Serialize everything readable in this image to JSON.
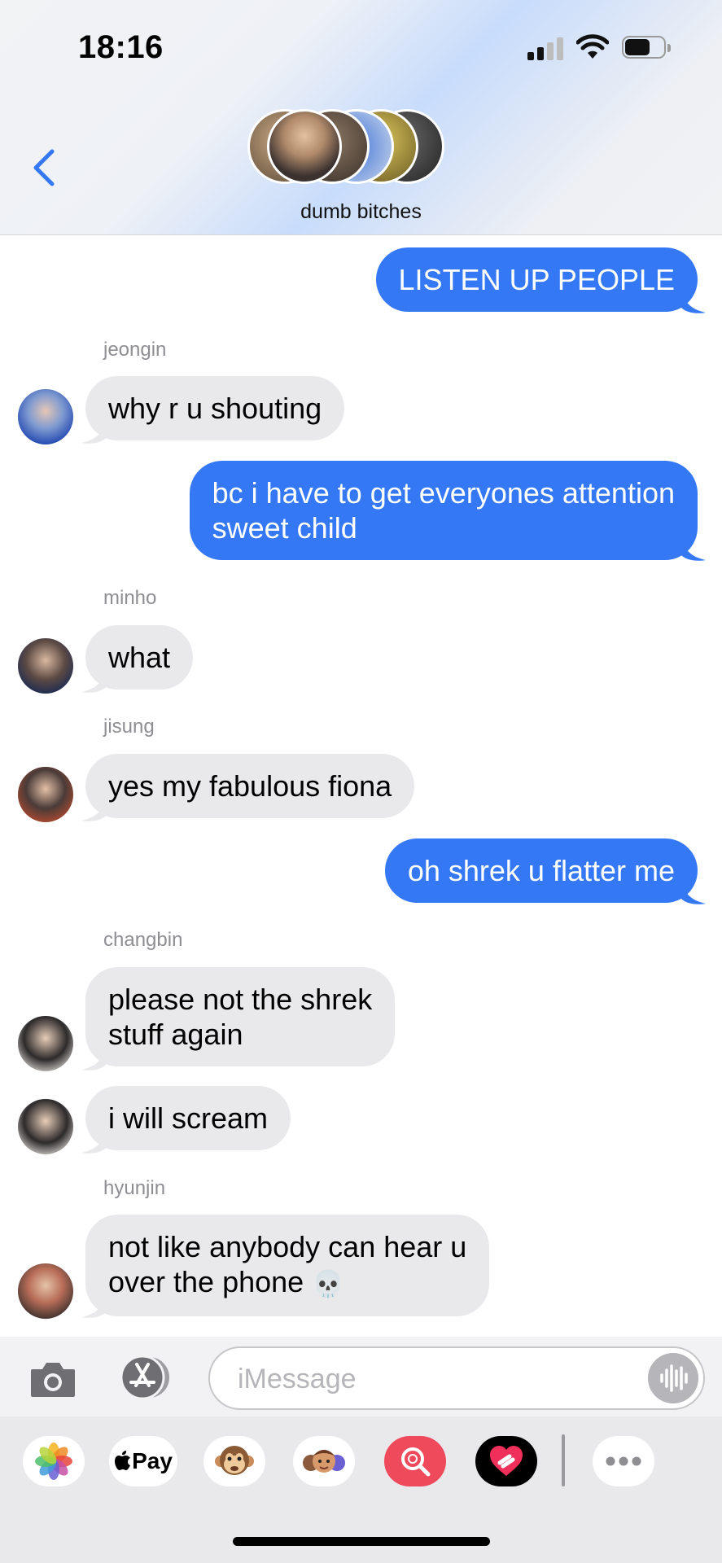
{
  "status_bar": {
    "time": "18:16"
  },
  "header": {
    "group_name": "dumb bitches"
  },
  "messages": [
    {
      "text": "LISTEN UP PEOPLE"
    },
    {
      "sender": "jeongin",
      "text": "why r u shouting"
    },
    {
      "line1": "bc i have to get everyones attention",
      "line2": "sweet child"
    },
    {
      "sender": "minho",
      "text": "what"
    },
    {
      "sender": "jisung",
      "text": "yes my fabulous fiona"
    },
    {
      "text": "oh shrek u flatter me"
    },
    {
      "sender": "changbin",
      "line1": "please not the shrek",
      "line2": "stuff again"
    },
    {
      "text": "i will scream"
    },
    {
      "sender": "hyunjin",
      "line1": "not like anybody can hear u",
      "line2": "over the phone",
      "emoji": "💀"
    }
  ],
  "input": {
    "placeholder": "iMessage"
  },
  "apps": {
    "apple_pay_label": "Pay"
  },
  "colors": {
    "outgoing": "#3478f6",
    "incoming": "#e9e9eb",
    "sender_label": "#8e8e93"
  },
  "icons": [
    "back-chevron-icon",
    "signal-icon",
    "wifi-icon",
    "battery-icon",
    "camera-icon",
    "app-store-icon",
    "audio-waveform-icon",
    "photos-icon",
    "apple-logo-icon",
    "monkey-emoji-icon",
    "memoji-icon",
    "image-search-icon",
    "digital-touch-icon",
    "more-icon"
  ]
}
